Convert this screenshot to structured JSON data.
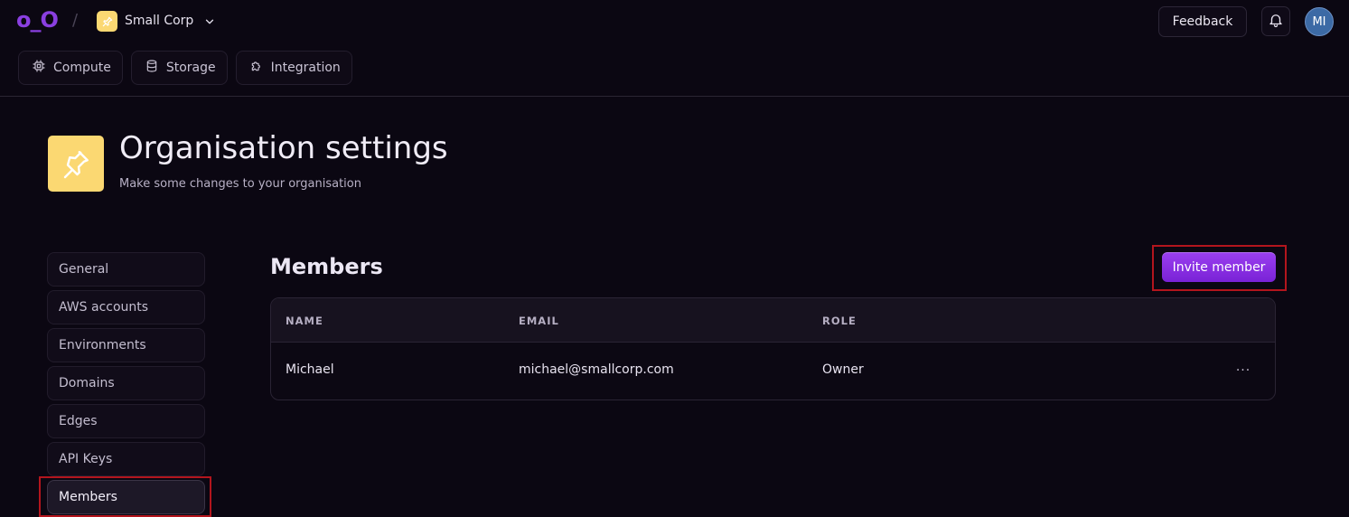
{
  "app": {
    "logo_text": "o_O",
    "org_name": "Small Corp"
  },
  "topbar": {
    "feedback_label": "Feedback",
    "avatar_initials": "MI"
  },
  "nav": {
    "tabs": [
      {
        "label": "Compute",
        "icon": "cpu-icon"
      },
      {
        "label": "Storage",
        "icon": "database-icon"
      },
      {
        "label": "Integration",
        "icon": "puzzle-icon"
      }
    ]
  },
  "header": {
    "title": "Organisation settings",
    "subtitle": "Make some changes to your organisation"
  },
  "sidebar": {
    "items": [
      {
        "label": "General"
      },
      {
        "label": "AWS accounts"
      },
      {
        "label": "Environments"
      },
      {
        "label": "Domains"
      },
      {
        "label": "Edges"
      },
      {
        "label": "API Keys"
      },
      {
        "label": "Members",
        "active": true
      }
    ]
  },
  "members": {
    "title": "Members",
    "invite_label": "Invite member",
    "columns": [
      "NAME",
      "EMAIL",
      "ROLE"
    ],
    "rows": [
      {
        "name": "Michael",
        "email": "michael@smallcorp.com",
        "role": "Owner",
        "actions": "···"
      }
    ]
  },
  "colors": {
    "background": "#0b0712",
    "accent": "#8a3fe0",
    "org_badge": "#fbd872",
    "highlight": "#b3151d"
  }
}
